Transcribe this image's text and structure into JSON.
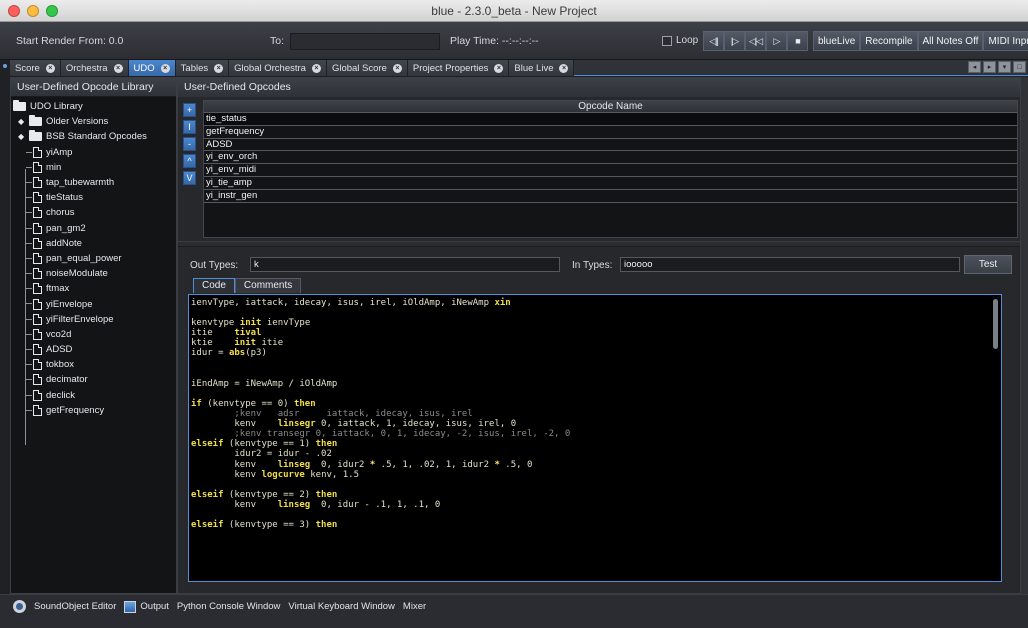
{
  "window": {
    "title": "blue - 2.3.0_beta - New Project",
    "lights": [
      "#fc605c",
      "#fdbc40",
      "#34c84a"
    ]
  },
  "toolbar": {
    "start_render_label": "Start Render From: 0.0",
    "to_label": "To:",
    "play_time_label": "Play Time: --:--:--:--",
    "loop_label": "Loop",
    "transport": [
      {
        "icon": "rewind-icon",
        "glyph": "◁||"
      },
      {
        "icon": "step-back-icon",
        "glyph": "|▷"
      },
      {
        "icon": "previous-icon",
        "glyph": "◁|◁"
      },
      {
        "icon": "play-icon",
        "glyph": "▷"
      },
      {
        "icon": "stop-icon",
        "glyph": "■"
      }
    ],
    "buttons": [
      "blueLive",
      "Recompile",
      "All Notes Off",
      "MIDI Inpu"
    ]
  },
  "tabs": [
    {
      "label": "Score"
    },
    {
      "label": "Orchestra"
    },
    {
      "label": "UDO",
      "active": true
    },
    {
      "label": "Tables"
    },
    {
      "label": "Global Orchestra"
    },
    {
      "label": "Global Score"
    },
    {
      "label": "Project Properties"
    },
    {
      "label": "Blue Live"
    }
  ],
  "library": {
    "title": "User-Defined Opcode Library",
    "root": "UDO Library",
    "folders": [
      "Older Versions",
      "BSB Standard Opcodes"
    ],
    "items": [
      "yiAmp",
      "min",
      "tap_tubewarmth",
      "tieStatus",
      "chorus",
      "pan_gm2",
      "addNote",
      "pan_equal_power",
      "noiseModulate",
      "ftmax",
      "yiEnvelope",
      "yiFilterEnvelope",
      "vco2d",
      "ADSD",
      "tokbox",
      "decimator",
      "declick",
      "getFrequency"
    ]
  },
  "udo": {
    "title": "User-Defined Opcodes",
    "column_header": "Opcode Name",
    "side_buttons": [
      "+",
      "I",
      "-",
      "^",
      "V"
    ],
    "rows": [
      "tie_status",
      "getFrequency",
      "ADSD",
      "yi_env_orch",
      "yi_env_midi",
      "yi_tie_amp",
      "yi_instr_gen"
    ],
    "out_types_label": "Out Types:",
    "out_types_value": "k",
    "in_types_label": "In Types:",
    "in_types_value": "iooooo",
    "test_label": "Test",
    "code_tab": "Code",
    "comments_tab": "Comments"
  },
  "code_lines": [
    [
      {
        "t": "ienvType, iattack, idecay, isus, irel, iOldAmp, iNewAmp "
      },
      {
        "t": "xin",
        "c": "kw"
      }
    ],
    [],
    [
      {
        "t": "kenvtype "
      },
      {
        "t": "init",
        "c": "kw"
      },
      {
        "t": " ienvType"
      }
    ],
    [
      {
        "t": "itie    "
      },
      {
        "t": "tival",
        "c": "kw"
      }
    ],
    [
      {
        "t": "ktie    "
      },
      {
        "t": "init",
        "c": "kw"
      },
      {
        "t": " itie"
      }
    ],
    [
      {
        "t": "idur = "
      },
      {
        "t": "abs",
        "c": "kw"
      },
      {
        "t": "(p3)"
      }
    ],
    [],
    [],
    [
      {
        "t": "iEndAmp = iNewAmp / iOldAmp"
      }
    ],
    [],
    [
      {
        "t": "if",
        "c": "kw"
      },
      {
        "t": " (kenvtype == 0) "
      },
      {
        "t": "then",
        "c": "kw"
      }
    ],
    [
      {
        "t": "        ;kenv   adsr     iattack, idecay, isus, irel",
        "c": "cm"
      }
    ],
    [
      {
        "t": "        kenv    "
      },
      {
        "t": "linsegr",
        "c": "kw"
      },
      {
        "t": " 0, iattack, 1, idecay, isus, irel, 0"
      }
    ],
    [
      {
        "t": "        ;kenv transegr 0, iattack, 0, 1, idecay, -2, isus, irel, -2, 0",
        "c": "cm"
      }
    ],
    [
      {
        "t": "elseif",
        "c": "kw"
      },
      {
        "t": " (kenvtype == 1) "
      },
      {
        "t": "then",
        "c": "kw"
      }
    ],
    [
      {
        "t": "        idur2 = idur - .02"
      }
    ],
    [
      {
        "t": "        kenv    "
      },
      {
        "t": "linseg",
        "c": "kw"
      },
      {
        "t": "  0, idur2 "
      },
      {
        "t": "*",
        "c": "op"
      },
      {
        "t": " .5, 1, .02, 1, idur2 "
      },
      {
        "t": "*",
        "c": "op"
      },
      {
        "t": " .5, 0"
      }
    ],
    [
      {
        "t": "        kenv "
      },
      {
        "t": "logcurve",
        "c": "kw"
      },
      {
        "t": " kenv, 1.5"
      }
    ],
    [],
    [
      {
        "t": "elseif",
        "c": "kw"
      },
      {
        "t": " (kenvtype == 2) "
      },
      {
        "t": "then",
        "c": "kw"
      }
    ],
    [
      {
        "t": "        kenv    "
      },
      {
        "t": "linseg",
        "c": "kw"
      },
      {
        "t": "  0, idur - .1, 1, .1, 0"
      }
    ],
    [],
    [
      {
        "t": "elseif",
        "c": "kw"
      },
      {
        "t": " (kenvtype == 3) "
      },
      {
        "t": "then",
        "c": "kw"
      }
    ]
  ],
  "bottom": {
    "items": [
      "SoundObject Editor",
      "Output",
      "Python Console Window",
      "Virtual Keyboard Window",
      "Mixer"
    ]
  },
  "colors": {
    "accent": "#4c86cf",
    "code_keyword": "#f0dd4a",
    "code_comment": "#8b8b8b"
  }
}
